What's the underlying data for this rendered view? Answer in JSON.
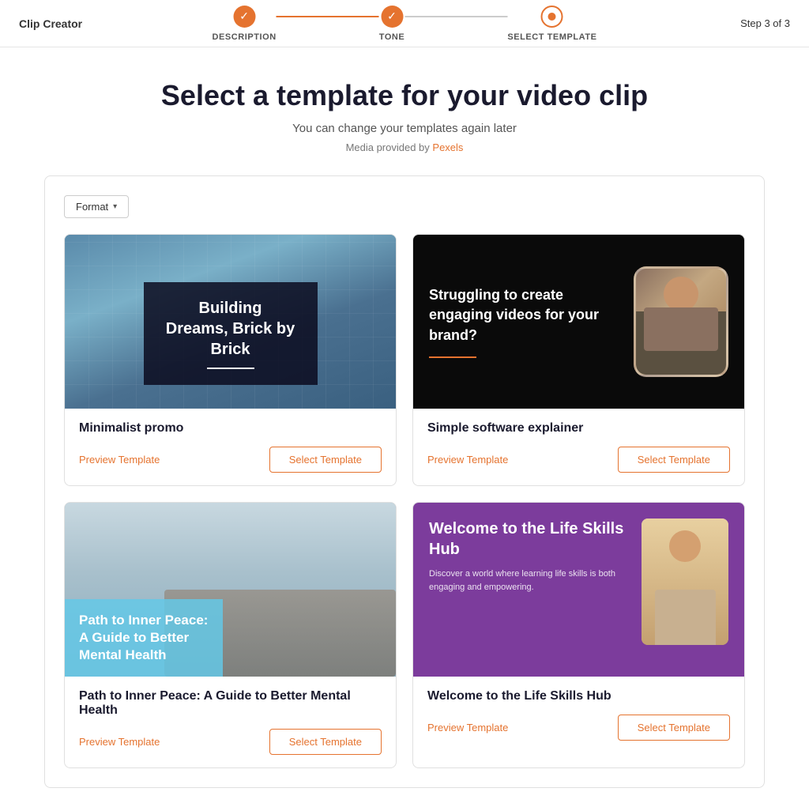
{
  "app": {
    "title": "Clip Creator"
  },
  "nav": {
    "step_count": "Step 3 of 3",
    "steps": [
      {
        "id": "description",
        "label": "DESCRIPTION",
        "state": "done"
      },
      {
        "id": "tone",
        "label": "TONE",
        "state": "done"
      },
      {
        "id": "select_template",
        "label": "SELECT TEMPLATE",
        "state": "active"
      }
    ]
  },
  "page": {
    "heading": "Select a template for your video clip",
    "subtitle": "You can change your templates again later",
    "media_credit_prefix": "Media provided by ",
    "media_credit_link": "Pexels"
  },
  "format_button": {
    "label": "Format"
  },
  "templates": [
    {
      "id": "minimalist-promo",
      "title": "Minimalist promo",
      "thumbnail_type": "minimalist",
      "overlay_text": "Building Dreams, Brick by Brick",
      "preview_label": "Preview Template",
      "select_label": "Select Template"
    },
    {
      "id": "simple-software-explainer",
      "title": "Simple software explainer",
      "thumbnail_type": "software",
      "overlay_text": "Struggling to create engaging videos for your brand?",
      "preview_label": "Preview Template",
      "select_label": "Select Template"
    },
    {
      "id": "mental-health",
      "title": "Path to Inner Peace: A Guide to Better Mental Health",
      "thumbnail_type": "mental",
      "overlay_text": "Path to Inner Peace: A Guide to Better Mental Health",
      "preview_label": "Preview Template",
      "select_label": "Select Template"
    },
    {
      "id": "life-skills",
      "title": "Welcome to the Life Skills Hub",
      "thumbnail_type": "life",
      "overlay_text_main": "Welcome to the Life Skills Hub",
      "overlay_text_sub": "Discover a world where learning life skills is both engaging and empowering.",
      "preview_label": "Preview Template",
      "select_label": "Select Template"
    }
  ]
}
